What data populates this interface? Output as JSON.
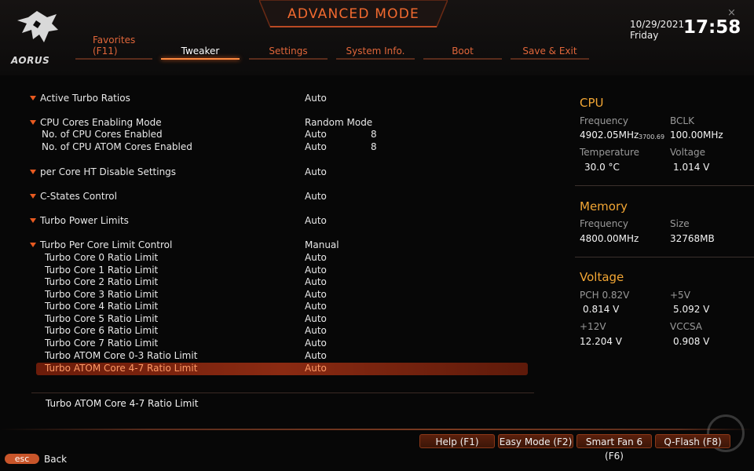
{
  "header": {
    "title": "ADVANCED MODE",
    "logo_text": "AORUS",
    "date": "10/29/2021",
    "day": "Friday",
    "time": "17:58",
    "close_glyph": "×",
    "favorites_label": "Favorites",
    "favorites_key": "(F11)",
    "tabs": [
      {
        "label": "Tweaker",
        "active": true
      },
      {
        "label": "Settings",
        "active": false
      },
      {
        "label": "System Info.",
        "active": false
      },
      {
        "label": "Boot",
        "active": false
      },
      {
        "label": "Save & Exit",
        "active": false
      }
    ]
  },
  "settings": {
    "active_turbo_ratios": {
      "label": "Active Turbo Ratios",
      "value": "Auto"
    },
    "cpu_cores_enabling_mode": {
      "label": "CPU Cores Enabling Mode",
      "value": "Random Mode"
    },
    "cpu_cores_enabled": {
      "label": "No. of CPU Cores Enabled",
      "value": "Auto",
      "count": "8"
    },
    "cpu_atom_cores_enabled": {
      "label": "No. of CPU ATOM Cores Enabled",
      "value": "Auto",
      "count": "8"
    },
    "per_core_ht": {
      "label": "per Core HT Disable Settings",
      "value": "Auto"
    },
    "c_states": {
      "label": "C-States Control",
      "value": "Auto"
    },
    "turbo_power_limits": {
      "label": "Turbo Power Limits",
      "value": "Auto"
    },
    "turbo_per_core_limit": {
      "label": "Turbo Per Core Limit Control",
      "value": "Manual"
    },
    "core_limits": [
      {
        "label": "Turbo Core 0 Ratio Limit",
        "value": "Auto"
      },
      {
        "label": "Turbo Core 1 Ratio Limit",
        "value": "Auto"
      },
      {
        "label": "Turbo Core 2 Ratio Limit",
        "value": "Auto"
      },
      {
        "label": "Turbo Core 3 Ratio Limit",
        "value": "Auto"
      },
      {
        "label": "Turbo Core 4 Ratio Limit",
        "value": "Auto"
      },
      {
        "label": "Turbo Core 5 Ratio Limit",
        "value": "Auto"
      },
      {
        "label": "Turbo Core 6 Ratio Limit",
        "value": "Auto"
      },
      {
        "label": "Turbo Core 7 Ratio Limit",
        "value": "Auto"
      },
      {
        "label": "Turbo ATOM Core 0-3 Ratio Limit",
        "value": "Auto"
      },
      {
        "label": "Turbo ATOM Core 4-7 Ratio Limit",
        "value": "Auto"
      }
    ]
  },
  "help_text": "Turbo ATOM Core 4-7 Ratio Limit",
  "cpu_panel": {
    "title": "CPU",
    "frequency_label": "Frequency",
    "frequency_value": "4902.05MHz",
    "frequency_small": "3700.69",
    "bclk_label": "BCLK",
    "bclk_value": "100.00MHz",
    "temperature_label": "Temperature",
    "temperature_value": "30.0 °C",
    "voltage_label": "Voltage",
    "voltage_value": "1.014 V"
  },
  "memory_panel": {
    "title": "Memory",
    "frequency_label": "Frequency",
    "frequency_value": "4800.00MHz",
    "size_label": "Size",
    "size_value": "32768MB"
  },
  "voltage_panel": {
    "title": "Voltage",
    "pch_label": "PCH 0.82V",
    "pch_value": "0.814 V",
    "v5_label": "+5V",
    "v5_value": "5.092 V",
    "v12_label": "+12V",
    "v12_value": "12.204 V",
    "vccsa_label": "VCCSA",
    "vccsa_value": "0.908 V"
  },
  "footer": {
    "buttons": [
      "Help (F1)",
      "Easy Mode (F2)",
      "Smart Fan 6 (F6)",
      "Q-Flash (F8)"
    ],
    "esc_label": "esc",
    "back_label": "Back"
  },
  "colors": {
    "accent": "#e0663a",
    "title": "#f26a2f",
    "panel_title": "#f2a634",
    "selected_bar": "#8a2a12"
  }
}
